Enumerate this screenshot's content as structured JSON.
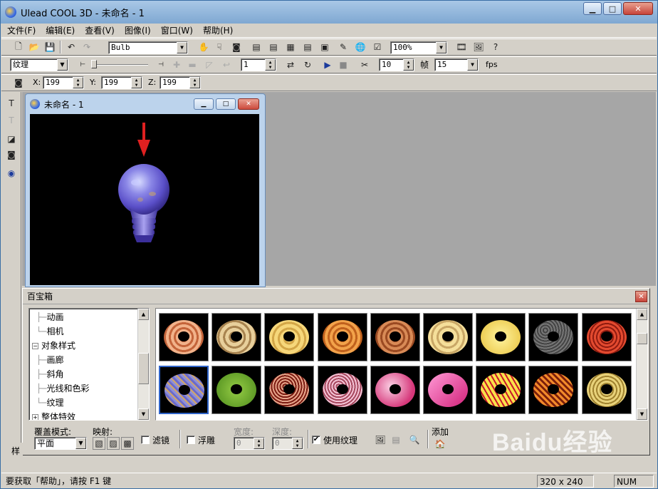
{
  "window": {
    "title": "Ulead COOL 3D - 未命名 - 1",
    "min_label": "▁",
    "max_label": "□",
    "close_label": "✕"
  },
  "menu": [
    "文件(F)",
    "编辑(E)",
    "查看(V)",
    "图像(I)",
    "窗口(W)",
    "帮助(H)"
  ],
  "toolbar1": {
    "object_name": "Bulb",
    "zoom": "100%"
  },
  "toolbar2": {
    "category": "纹理",
    "frame_value": "1",
    "frames_total": "10",
    "frames_label": "帧",
    "fps_value": "15",
    "fps_label": "fps"
  },
  "toolbar3": {
    "x_label": "X:",
    "x_value": "199",
    "y_label": "Y:",
    "y_value": "199",
    "z_label": "Z:",
    "z_value": "199"
  },
  "document": {
    "title": "未命名 - 1"
  },
  "palette": {
    "title": "百宝箱",
    "tree": [
      {
        "label": "动画",
        "level": 2
      },
      {
        "label": "相机",
        "level": 2
      },
      {
        "label": "对象样式",
        "level": 1,
        "expanded": true
      },
      {
        "label": "画廊",
        "level": 2
      },
      {
        "label": "斜角",
        "level": 2
      },
      {
        "label": "光线和色彩",
        "level": 2
      },
      {
        "label": "纹理",
        "level": 2
      },
      {
        "label": "整体特效",
        "level": 1,
        "expanded": false
      }
    ],
    "textures": [
      "peach-wood",
      "tan-wood",
      "pine-wood",
      "amber-wood",
      "walnut-wood",
      "cream-wood",
      "yellow-wood",
      "granite",
      "red-scales",
      "blue-marble",
      "green-moss",
      "red-pebbles",
      "pink-granite",
      "pink-swirl",
      "magenta-gloss",
      "yellow-flame",
      "orange-weave",
      "khaki-pattern"
    ],
    "options": {
      "cover_mode_label": "覆盖模式:",
      "cover_mode_value": "平面",
      "mapping_label": "映射:",
      "filter_label": "滤镜",
      "emboss_label": "浮雕",
      "width_label": "宽度:",
      "width_value": "0",
      "depth_label": "深度:",
      "depth_value": "0",
      "use_texture_label": "使用纹理",
      "use_texture_checked": true,
      "add_label": "添加"
    }
  },
  "side_strip_label": "样",
  "status": {
    "help_text": "要获取「帮助」，请按 F1 键",
    "size": "320 x 240",
    "num": "NUM"
  },
  "watermark": "Baidu经验"
}
